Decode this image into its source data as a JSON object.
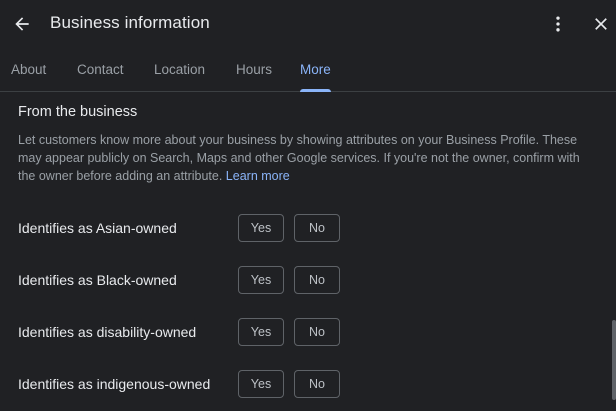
{
  "header": {
    "title": "Business information"
  },
  "tabs": [
    {
      "label": "About",
      "active": false
    },
    {
      "label": "Contact",
      "active": false
    },
    {
      "label": "Location",
      "active": false
    },
    {
      "label": "Hours",
      "active": false
    },
    {
      "label": "More",
      "active": true
    }
  ],
  "section": {
    "title": "From the business",
    "description": "Let customers know more about your business by showing attributes on your Business Profile. These may appear publicly on Search, Maps and other Google services. If you're not the owner, confirm with the owner before adding an attribute.",
    "learn_more": "Learn more"
  },
  "attributes": [
    {
      "label": "Identifies as Asian-owned",
      "yes": "Yes",
      "no": "No"
    },
    {
      "label": "Identifies as Black-owned",
      "yes": "Yes",
      "no": "No"
    },
    {
      "label": "Identifies as disability-owned",
      "yes": "Yes",
      "no": "No"
    },
    {
      "label": "Identifies as indigenous-owned",
      "yes": "Yes",
      "no": "No"
    }
  ],
  "colors": {
    "background": "#202124",
    "accent": "#8ab4f8",
    "text": "#e8eaed",
    "muted": "#9aa0a6",
    "border": "#5f6368"
  }
}
